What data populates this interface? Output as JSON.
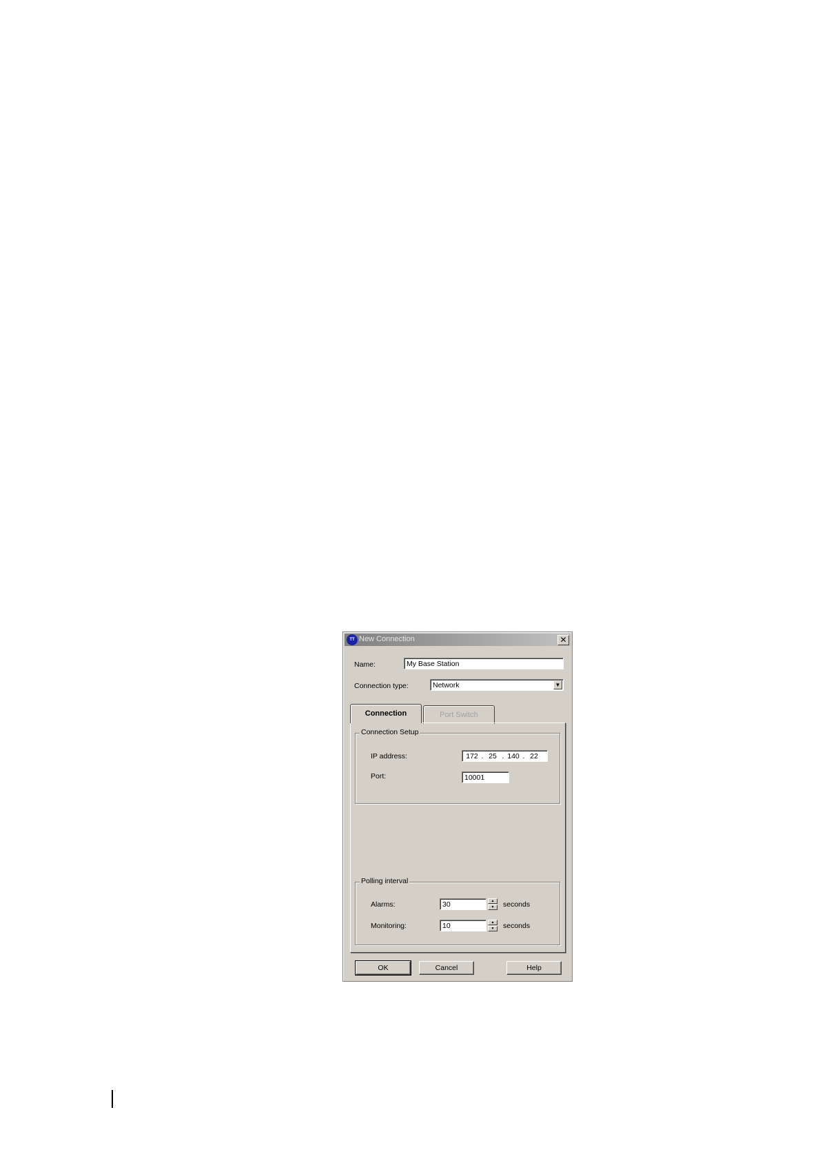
{
  "dialog": {
    "title": "New Connection",
    "icon_text": "TT",
    "close_label": "✕",
    "name_label": "Name:",
    "name_value": "My Base Station",
    "connection_type_label": "Connection type:",
    "connection_type_value": "Network",
    "tabs": [
      {
        "label": "Connection",
        "active": true
      },
      {
        "label": "Port Switch",
        "active": false
      }
    ],
    "connection_setup": {
      "title": "Connection Setup",
      "ip_label": "IP address:",
      "ip_octets": [
        "172",
        "25",
        "140",
        "22"
      ],
      "port_label": "Port:",
      "port_value": "10001"
    },
    "polling_interval": {
      "title": "Polling interval",
      "alarms_label": "Alarms:",
      "alarms_value": "30",
      "monitoring_label": "Monitoring:",
      "monitoring_value": "10",
      "unit": "seconds"
    },
    "buttons": {
      "ok": "OK",
      "cancel": "Cancel",
      "help": "Help"
    }
  }
}
